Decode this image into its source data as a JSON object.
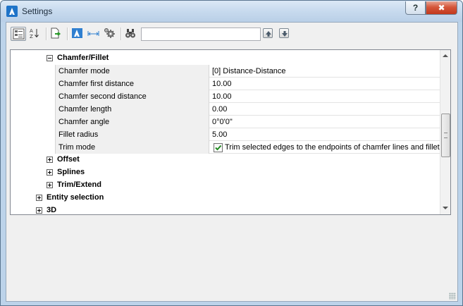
{
  "window": {
    "title": "Settings",
    "help_label": "?",
    "close_label": "✖"
  },
  "toolbar": {
    "tools": [
      {
        "name": "categorized-view",
        "icon": "categorized-list-icon",
        "pressed": true
      },
      {
        "name": "alphabetical-view",
        "icon": "sort-az-icon",
        "pressed": false
      },
      {
        "name": "export",
        "icon": "export-document-icon",
        "pressed": false
      },
      {
        "name": "bricscad-variables",
        "icon": "app-logo-icon",
        "pressed": false
      },
      {
        "name": "dimension-variables",
        "icon": "dimension-icon",
        "pressed": false
      },
      {
        "name": "settings-filter",
        "icon": "gear-cog-icon",
        "pressed": false
      },
      {
        "name": "find",
        "icon": "binoculars-icon",
        "pressed": false
      }
    ],
    "search": {
      "value": "",
      "placeholder": ""
    }
  },
  "tree": {
    "chamfer_fillet": {
      "label": "Chamfer/Fillet",
      "expanded": true,
      "properties": [
        {
          "name": "Chamfer mode",
          "value": "[0] Distance-Distance"
        },
        {
          "name": "Chamfer first distance",
          "value": "10.00"
        },
        {
          "name": "Chamfer second distance",
          "value": "10.00"
        },
        {
          "name": "Chamfer length",
          "value": "0.00"
        },
        {
          "name": "Chamfer angle",
          "value": "0°0'0\""
        },
        {
          "name": "Fillet radius",
          "value": "5.00"
        }
      ],
      "trim_mode": {
        "name": "Trim mode",
        "checked": true,
        "label": "Trim selected edges to the endpoints of chamfer lines and fillet arcs"
      }
    },
    "siblings": [
      {
        "label": "Offset"
      },
      {
        "label": "Splines"
      },
      {
        "label": "Trim/Extend"
      }
    ],
    "top_level": [
      {
        "label": "Entity selection"
      },
      {
        "label": "3D"
      }
    ]
  },
  "colors": {
    "titlebar": "#c7daee",
    "client": "#f0f0f0",
    "property_name_bg": "#f0f0f0",
    "close_button": "#c2391c"
  }
}
